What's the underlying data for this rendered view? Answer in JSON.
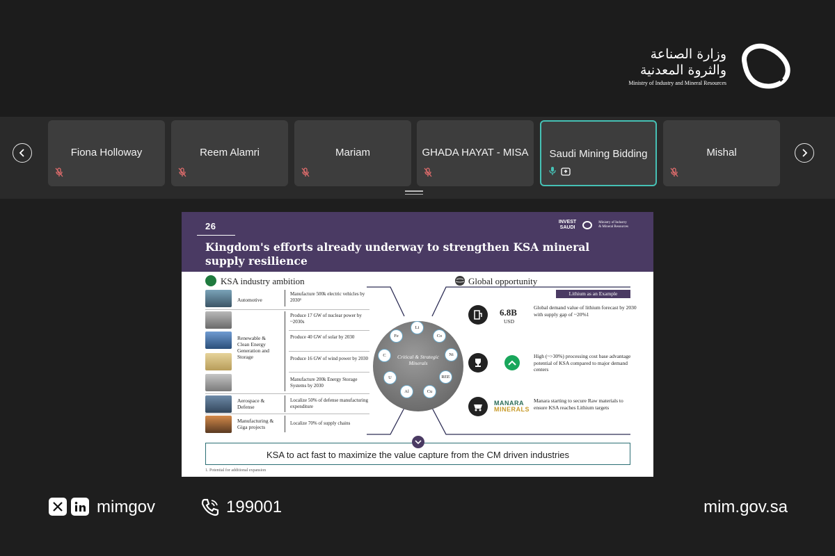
{
  "brand": {
    "arabic_line1": "وزارة الصناعة",
    "arabic_line2": "والثروة المعدنية",
    "english": "Ministry of Industry and Mineral Resources"
  },
  "participants": [
    {
      "name": "Fiona Holloway",
      "muted": true,
      "active": false
    },
    {
      "name": "Reem Alamri",
      "muted": true,
      "active": false
    },
    {
      "name": "Mariam",
      "muted": true,
      "active": false
    },
    {
      "name": "GHADA HAYAT - MISA",
      "muted": true,
      "active": false
    },
    {
      "name": "Saudi Mining Bidding",
      "muted": false,
      "active": true
    },
    {
      "name": "Mishal",
      "muted": true,
      "active": false
    }
  ],
  "slide": {
    "number": "26",
    "logo_invest_line1": "INVEST",
    "logo_invest_line2": "SAUDI",
    "logo_ministry_line1": "Ministry of Industry",
    "logo_ministry_line2": "& Mineral Resources",
    "title": "Kingdom's efforts already underway to strengthen KSA mineral supply resilience",
    "left_section": "KSA industry ambition",
    "right_section": "Global opportunity",
    "categories": [
      "Automotive",
      "Renewable & Clean Energy Generation and Storage",
      "Aerospace & Defense",
      "Manufacturing & Giga projects"
    ],
    "items": [
      "Manufacture 500k electric vehicles by 2030¹",
      "Produce 17 GW of nuclear power by ~2030s",
      "Produce 40 GW of solar by 2030",
      "Produce 16 GW of wind power by 2030",
      "Manufacture 200k Energy Storage Systems by 2030",
      "Localize 50% of defense manufacturing expenditure",
      "Localize 70% of supply chains"
    ],
    "wheel_label": "Critical & Strategic Minerals",
    "minerals": [
      "Li",
      "Co",
      "Ni",
      "REE",
      "Cu",
      "Al",
      "U",
      "C",
      "Fe"
    ],
    "example_badge": "Lithium as an Example",
    "stat_value": "6.8B",
    "stat_unit": "USD",
    "opportunities": [
      "Global demand value of lithium forecast by 2030 with supply gap of ~20%1",
      "High (~>30%) processing cost base advantage potential of KSA compared to major demand centers",
      "Manara starting to secure Raw materials to ensure KSA reaches Lithium targets"
    ],
    "manara_line1": "MANARA",
    "manara_line2": "MINERALS",
    "conclusion": "KSA to act fast to maximize the value capture from the CM driven industries",
    "footnote": "1. Potential for additional expansion"
  },
  "footer": {
    "social_handle": "mimgov",
    "phone": "199001",
    "website": "mim.gov.sa"
  },
  "colors": {
    "slide_header": "#4a3a63",
    "active_tile_border": "#46c1b5",
    "muted_icon": "#e06c6c"
  }
}
